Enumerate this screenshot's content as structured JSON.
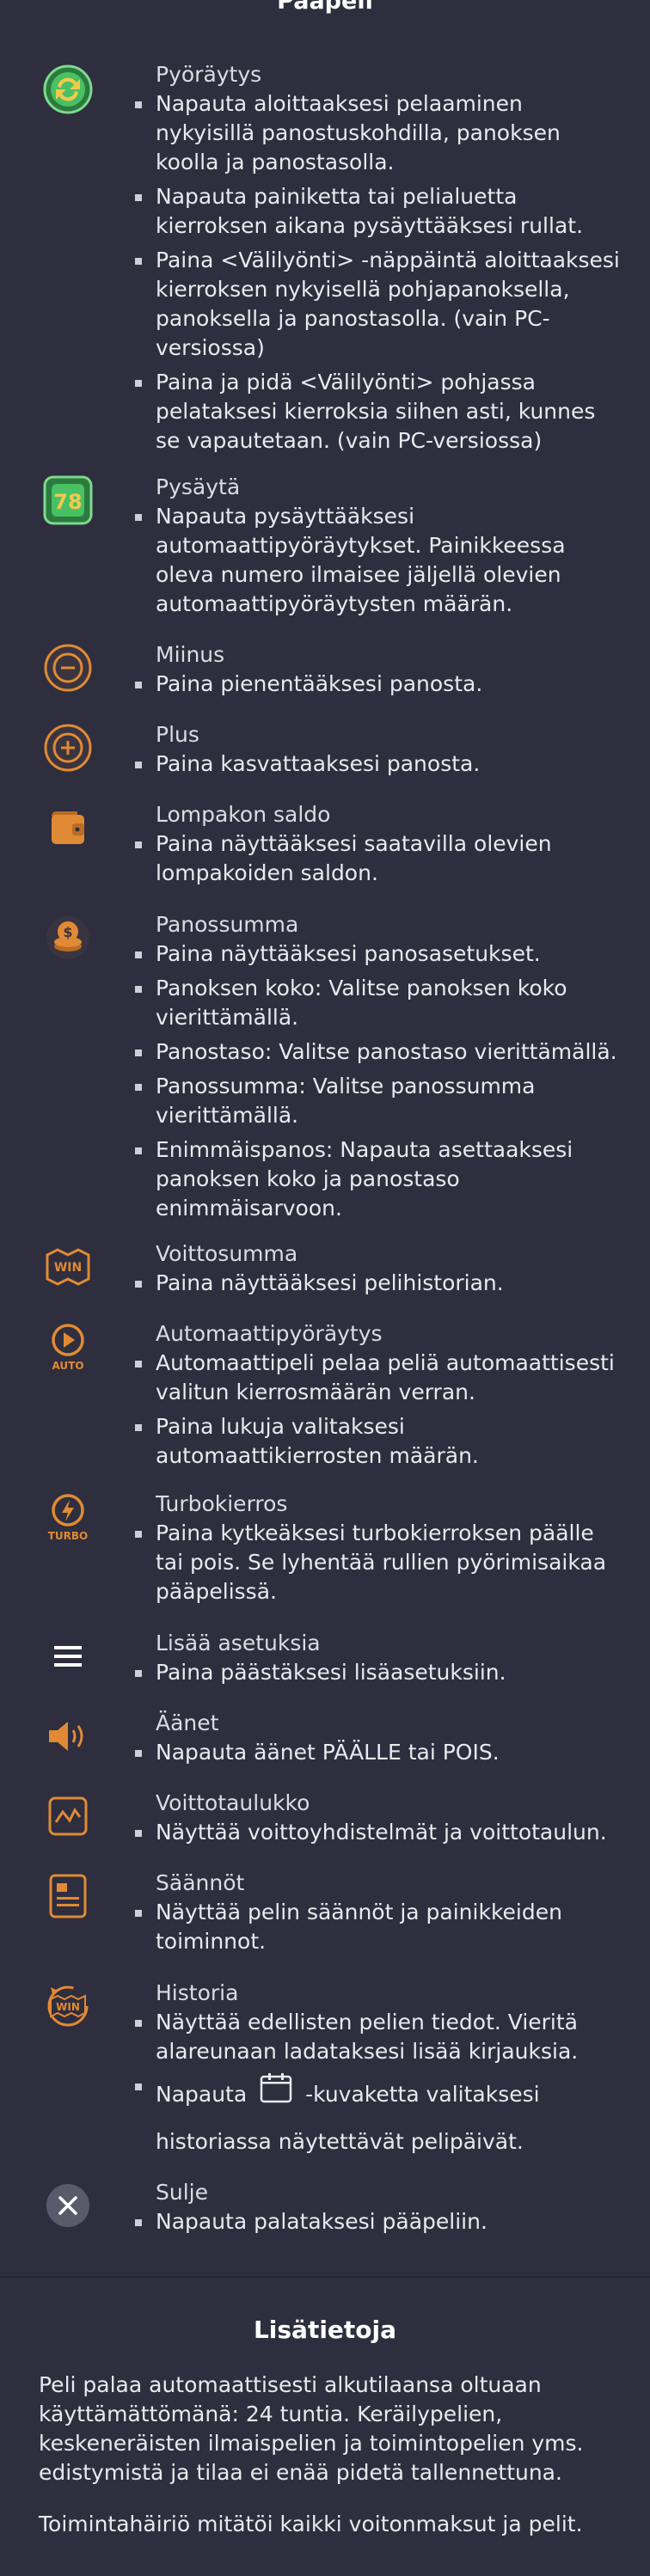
{
  "main_title": "Pääpeli",
  "items": [
    {
      "title": "Pyöräytys",
      "bullets": [
        "Napauta aloittaaksesi pelaaminen nykyisillä panostuskohdilla, panoksen koolla ja panostasolla.",
        "Napauta painiketta tai pelialuetta kierroksen aikana pysäyttääksesi rullat.",
        "Paina <Välilyönti> -näppäintä aloittaaksesi kierroksen nykyisellä pohjapanoksella, panoksella ja panostasolla. (vain PC-versiossa)",
        "Paina ja pidä <Välilyönti> pohjassa pelataksesi kierroksia siihen asti, kunnes se vapautetaan. (vain PC-versiossa)"
      ]
    },
    {
      "title": "Pysäytä",
      "bullets": [
        "Napauta pysäyttääksesi automaattipyöräytykset. Painikkeessa oleva numero ilmaisee jäljellä olevien automaattipyöräytysten määrän."
      ],
      "icon_number": "78"
    },
    {
      "title": "Miinus",
      "bullets": [
        "Paina pienentääksesi panosta."
      ]
    },
    {
      "title": "Plus",
      "bullets": [
        "Paina kasvattaaksesi panosta."
      ]
    },
    {
      "title": "Lompakon saldo",
      "bullets": [
        "Paina näyttääksesi saatavilla olevien lompakoiden saldon."
      ]
    },
    {
      "title": "Panossumma",
      "bullets": [
        "Paina näyttääksesi panosasetukset.",
        "Panoksen koko: Valitse panoksen koko vierittämällä.",
        "Panostaso: Valitse panostaso vierittämällä.",
        "Panossumma: Valitse panossumma vierittämällä.",
        "Enimmäispanos: Napauta asettaaksesi panoksen koko ja panostaso enimmäisarvoon."
      ]
    },
    {
      "title": "Voittosumma",
      "bullets": [
        "Paina näyttääksesi pelihistorian."
      ],
      "icon_text": "WIN"
    },
    {
      "title": "Automaattipyöräytys",
      "bullets": [
        "Automaattipeli pelaa peliä automaattisesti valitun kierrosmäärän verran.",
        "Paina lukuja valitaksesi automaattikierrosten määrän."
      ],
      "icon_text": "AUTO"
    },
    {
      "title": "Turbokierros",
      "bullets": [
        "Paina kytkeäksesi turbokierroksen päälle tai pois. Se lyhentää rullien pyörimisaikaa pääpelissä."
      ],
      "icon_text": "TURBO"
    },
    {
      "title": "Lisää asetuksia",
      "bullets": [
        "Paina päästäksesi lisäasetuksiin."
      ]
    },
    {
      "title": "Äänet",
      "bullets": [
        "Napauta äänet PÄÄLLE tai POIS."
      ]
    },
    {
      "title": "Voittotaulukko",
      "bullets": [
        "Näyttää voittoyhdistelmät ja voittotaulun."
      ]
    },
    {
      "title": "Säännöt",
      "bullets": [
        "Näyttää pelin säännöt ja painikkeiden toiminnot."
      ]
    },
    {
      "title": "Historia",
      "bullets": [
        "Näyttää edellisten pelien tiedot. Vieritä alareunaan ladataksesi lisää kirjauksia.",
        "Napauta",
        "-kuvaketta valitaksesi historiassa näytettävät pelipäivät."
      ],
      "icon_text": "WIN"
    },
    {
      "title": "Sulje",
      "bullets": [
        "Napauta palataksesi pääpeliin."
      ]
    }
  ],
  "info": {
    "title": "Lisätietoja",
    "paragraphs": [
      "Peli palaa automaattisesti alkutilaansa oltuaan käyttämättömänä: 24 tuntia. Keräilypelien, keskeneräisten ilmaispelien ja toimintopelien yms. edistymistä ja tilaa ei enää pidetä tallennettuna.",
      "Toimintahäiriö mitätöi kaikki voitonmaksut ja pelit."
    ]
  },
  "colors": {
    "background": "#2e2e3e",
    "accent_orange": "#e08a35",
    "icon_green": "#3dbb5a",
    "text": "#e9e9ef"
  }
}
